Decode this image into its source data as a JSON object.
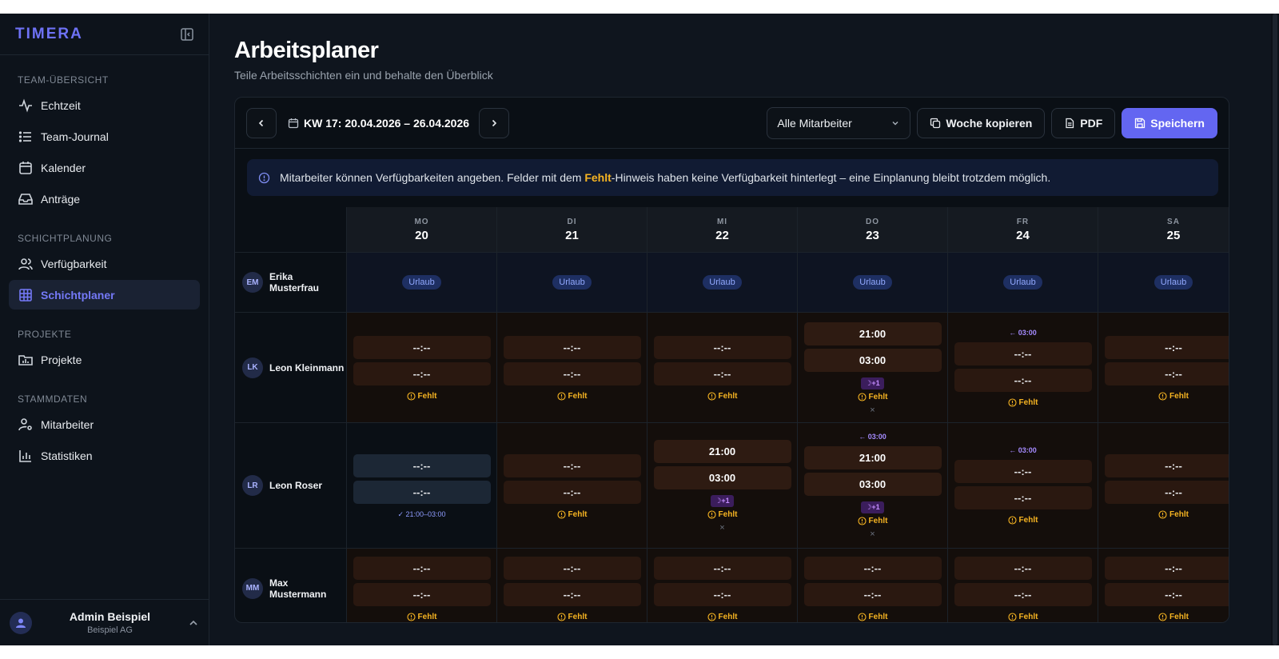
{
  "sidebar": {
    "brand": "TIMERA",
    "sections": [
      {
        "title": "TEAM-ÜBERSICHT",
        "items": [
          {
            "label": "Echtzeit",
            "icon": "activity-icon"
          },
          {
            "label": "Team-Journal",
            "icon": "list-icon"
          },
          {
            "label": "Kalender",
            "icon": "calendar-icon"
          },
          {
            "label": "Anträge",
            "icon": "inbox-icon"
          }
        ]
      },
      {
        "title": "SCHICHTPLANUNG",
        "items": [
          {
            "label": "Verfügbarkeit",
            "icon": "users-icon"
          },
          {
            "label": "Schichtplaner",
            "icon": "grid-icon",
            "active": true
          }
        ]
      },
      {
        "title": "PROJEKTE",
        "items": [
          {
            "label": "Projekte",
            "icon": "folder-chart-icon"
          }
        ]
      },
      {
        "title": "STAMMDATEN",
        "items": [
          {
            "label": "Mitarbeiter",
            "icon": "user-cog-icon"
          },
          {
            "label": "Statistiken",
            "icon": "bar-chart-icon"
          }
        ]
      }
    ],
    "user": {
      "name": "Admin Beispiel",
      "org": "Beispiel AG"
    }
  },
  "header": {
    "title": "Arbeitsplaner",
    "subtitle": "Teile Arbeitsschichten ein und behalte den Überblick"
  },
  "toolbar": {
    "week": "KW 17: 20.04.2026 – 26.04.2026",
    "filter": "Alle Mitarbeiter",
    "copy_label": "Woche kopieren",
    "pdf_label": "PDF",
    "save_label": "Speichern"
  },
  "info": {
    "before": "Mitarbeiter können Verfügbarkeiten angeben. Felder mit dem ",
    "highlight": "Fehlt",
    "after": "-Hinweis haben keine Verfügbarkeit hinterlegt – eine Einplanung bleibt trotzdem möglich."
  },
  "days": [
    {
      "dow": "MO",
      "num": "20"
    },
    {
      "dow": "DI",
      "num": "21"
    },
    {
      "dow": "MI",
      "num": "22"
    },
    {
      "dow": "DO",
      "num": "23"
    },
    {
      "dow": "FR",
      "num": "24"
    },
    {
      "dow": "SA",
      "num": "25"
    }
  ],
  "labels": {
    "empty_time": "--:--",
    "missing": "Fehlt",
    "vacation": "Urlaub",
    "next_day": "☽+1",
    "prev_day": "← 03:00",
    "remove": "×"
  },
  "employees": [
    {
      "initials": "EM",
      "name": "Erika Musterfrau"
    },
    {
      "initials": "LK",
      "name": "Leon Kleinmann"
    },
    {
      "initials": "LR",
      "name": "Leon Roser"
    },
    {
      "initials": "MM",
      "name": "Max Mustermann"
    }
  ],
  "shifts": {
    "leon_k_do": {
      "start": "21:00",
      "end": "03:00"
    },
    "leon_r_mi": {
      "start": "21:00",
      "end": "03:00"
    },
    "leon_r_do": {
      "start": "21:00",
      "end": "03:00"
    },
    "leon_r_mo_avail": "✓ 21:00–03:00"
  },
  "colors": {
    "accent": "#6366f1",
    "warning": "#f6b422",
    "background": "#0f151e"
  }
}
